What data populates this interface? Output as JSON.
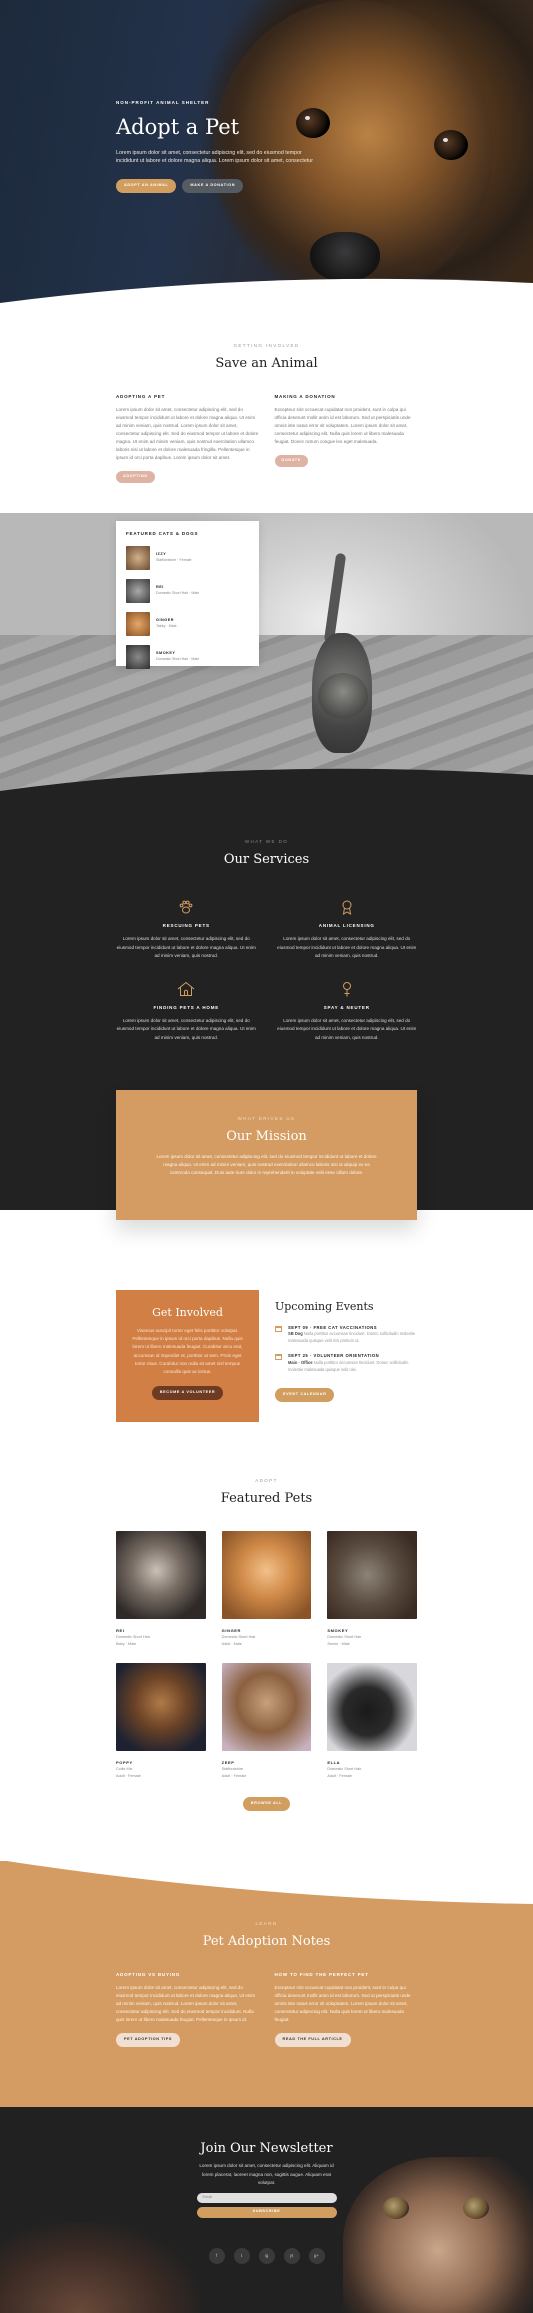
{
  "colors": {
    "accent": "#d19e5f",
    "dark": "#222222",
    "orange": "#d17f45"
  },
  "hero": {
    "kicker": "NON-PROFIT ANIMAL SHELTER",
    "title": "Adopt a Pet",
    "body": "Lorem ipsum dolor sit amet, consectetur adipiscing elit, sed do eiusmod tempor incididunt ut labore et dolore magna aliqua. Lorem ipsum dolor sit amet, consectetur",
    "btn_adopt": "ADOPT AN ANIMAL",
    "btn_donate": "MAKE A DONATION"
  },
  "save": {
    "eyebrow": "GETTING INVOLVED",
    "title": "Save an Animal",
    "col1_title": "ADOPTING A PET",
    "col1_body": "Lorem ipsum dolor sit amet, consectetur adipiscing elit, sed do eiusmod tempor incididunt ut labore et dolore magna aliqua. Ut enim ad minim veniam, quis nostrud. Lorem ipsum dolor sit amet, consectetur adipiscing elit. Sed do eiusmod tempor ut labore et dolore magna. Ut enim ad minim veniam, quis nostrud exercitation ullamco laboris nisi ut labore et dolore malesuada fringilla. Pellentesque in ipsum id orci porta dapibus. Lorem ipsum dolor sit amet.",
    "col1_btn": "ADOPTING",
    "col2_title": "MAKING A DONATION",
    "col2_body": "Excepteur sint occaecat cupidatat non proident, sunt in culpa qui officia deserunt mollit anim id est laborum. Sed ut perspiciatis unde omnis iste natus error sit voluptatem. Lorem ipsum dolor sit amet, consectetur adipiscing elit. Nulla quis lorem ut libero malesuada feugiat. Donec rutrum congue leo eget malesuada.",
    "col2_btn": "DONATE"
  },
  "featured_card": {
    "title": "FEATURED CATS & DOGS",
    "items": [
      {
        "name": "IZZY",
        "desc": "Staffordshire · Female"
      },
      {
        "name": "REI",
        "desc": "Domestic Short Hair · Male"
      },
      {
        "name": "GINGER",
        "desc": "Tabby · Male"
      },
      {
        "name": "SMOKEY",
        "desc": "Domestic Short Hair · Male"
      }
    ]
  },
  "services": {
    "eyebrow": "WHAT WE DO",
    "title": "Our Services",
    "items": [
      {
        "icon": "paw-icon",
        "title": "RESCUING PETS",
        "body": "Lorem ipsum dolor sit amet, consectetur adipiscing elit, sed do eiusmod tempor incididunt ut labore et dolore magna aliqua. Ut enim ad minim veniam, quis nostrud."
      },
      {
        "icon": "ribbon-icon",
        "title": "ANIMAL LICENSING",
        "body": "Lorem ipsum dolor sit amet, consectetur adipiscing elit, sed do eiusmod tempor incididunt ut labore et dolore magna aliqua. Ut enim ad minim veniam, quis nostrud."
      },
      {
        "icon": "house-icon",
        "title": "FINDING PETS A HOME",
        "body": "Lorem ipsum dolor sit amet, consectetur adipiscing elit, sed do eiusmod tempor incididunt ut labore et dolore magna aliqua. Ut enim ad minim veniam, quis nostrud."
      },
      {
        "icon": "female-icon",
        "title": "SPAY & NEUTER",
        "body": "Lorem ipsum dolor sit amet, consectetur adipiscing elit, sed do eiusmod tempor incididunt ut labore et dolore magna aliqua. Ut enim ad minim veniam, quis nostrud."
      }
    ]
  },
  "mission": {
    "eyebrow": "WHAT DRIVES US",
    "title": "Our Mission",
    "body": "Lorem ipsum dolor sit amet, consectetur adipiscing elit, sed do eiusmod tempor incididunt ut labore et dolore magna aliqua. Ut enim ad minim veniam, quis nostrud exercitation ullamco laboris nisi ut aliquip ex ea commodo consequat. Duis aute irure dolor in reprehenderit in voluptate velit esse cillum dolore."
  },
  "involved": {
    "title": "Get Involved",
    "body": "Vivamus suscipit tortor eget felis porttitor volutpat. Pellentesque in ipsum id orci porta dapibus. Nulla quis lorem ut libero malesuada feugiat. Curabitur arcu erat, accumsan id imperdiet et, porttitor at sem. Proin eget tortor risus. Curabitur non nulla sit amet nisl tempus convallis quis ac lectus.",
    "btn": "BECOME A VOLUNTEER"
  },
  "events": {
    "title": "Upcoming Events",
    "items": [
      {
        "title": "SEPT 09 · FREE CAT VACCINATIONS",
        "place": "SB Dog",
        "body": "Nulla porttitor accumsan tincidunt. Donec sollicitudin molestie malesuada quisque velit nisi pretium ut."
      },
      {
        "title": "SEPT 25 · VOLUNTEER ORIENTATION",
        "place": "Main · Office",
        "body": "Nulla porttitor accumsan tincidunt. Donec sollicitudin molestie malesuada quisque velit nisi."
      }
    ],
    "btn": "EVENT CALENDAR"
  },
  "pets": {
    "eyebrow": "ADOPT",
    "title": "Featured Pets",
    "items": [
      {
        "name": "REI",
        "d1": "Domestic Short Hair",
        "d2": "Baby · Male"
      },
      {
        "name": "GINGER",
        "d1": "Domestic Short Hair",
        "d2": "Adult · Male"
      },
      {
        "name": "SMOKEY",
        "d1": "Domestic Short Hair",
        "d2": "Senior · Male"
      },
      {
        "name": "POPPY",
        "d1": "Collie Mix",
        "d2": "Adult · Female"
      },
      {
        "name": "ZEEP",
        "d1": "Staffordshire",
        "d2": "Adult · Female"
      },
      {
        "name": "ELLA",
        "d1": "Domestic Short Hair",
        "d2": "Adult · Female"
      }
    ],
    "btn": "BROWSE ALL"
  },
  "notes": {
    "eyebrow": "LEARN",
    "title": "Pet Adoption Notes",
    "col1_title": "ADOPTING VS BUYING",
    "col1_body": "Lorem ipsum dolor sit amet, consectetur adipiscing elit, sed do eiusmod tempor incididunt ut labore et dolore magna aliqua. Ut enim ad minim veniam, quis nostrud. Lorem ipsum dolor sit amet, consectetur adipiscing elit. Sed do eiusmod tempor incididunt. Nulla quis lorem ut libero malesuada feugiat. Pellentesque in ipsum id.",
    "col1_btn": "PET ADOPTION TIPS",
    "col2_title": "HOW TO FIND THE PERFECT PET",
    "col2_body": "Excepteur sint occaecat cupidatat non proident, sunt in culpa qui officia deserunt mollit anim id est laborum. Sed ut perspiciatis unde omnis iste natus error sit voluptatem. Lorem ipsum dolor sit amet, consectetur adipiscing elit. Nulla quis lorem ut libero malesuada feugiat.",
    "col2_btn": "READ THE FULL ARTICLE"
  },
  "newsletter": {
    "title": "Join Our Newsletter",
    "body": "Lorem ipsum dolor sit amet, consectetur adipiscing elit. Aliquam id lorem placerat, laoreet magna non, sagittis augue. Aliquam erat volutpat.",
    "email_placeholder": "Email",
    "btn": "SUBSCRIBE",
    "social": [
      "f",
      "t",
      "ig",
      "yt",
      "g+"
    ]
  }
}
